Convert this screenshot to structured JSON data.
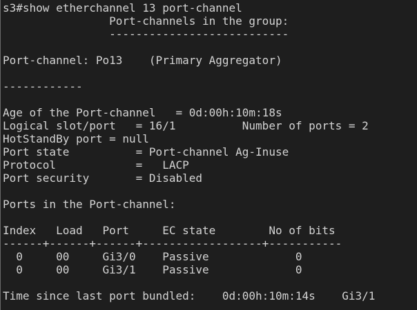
{
  "terminal": {
    "lines": [
      "s3#show etherchannel 13 port-channel",
      "                Port-channels in the group:",
      "                ---------------------------",
      "",
      "Port-channel: Po13    (Primary Aggregator)",
      "",
      "------------",
      "",
      "Age of the Port-channel   = 0d:00h:10m:18s",
      "Logical slot/port   = 16/1          Number of ports = 2",
      "HotStandBy port = null",
      "Port state          = Port-channel Ag-Inuse",
      "Protocol            =   LACP",
      "Port security       = Disabled",
      "",
      "Ports in the Port-channel:",
      "",
      "Index   Load   Port     EC state        No of bits",
      "------+------+------+------------------+-----------",
      "  0     00     Gi3/0    Passive             0",
      "  0     00     Gi3/1    Passive             0",
      "",
      "Time since last port bundled:    0d:00h:10m:14s    Gi3/1",
      ""
    ]
  }
}
